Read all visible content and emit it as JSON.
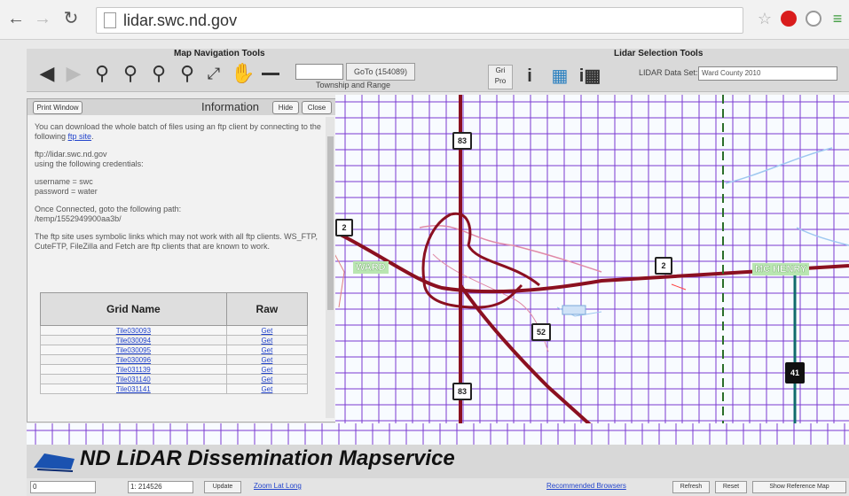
{
  "browser": {
    "url": "lidar.swc.nd.gov",
    "back_icon": "left-arrow-icon",
    "forward_icon": "right-arrow-icon",
    "reload_icon": "reload-icon"
  },
  "toolbar": {
    "nav_title": "Map Navigation Tools",
    "lidar_title": "Lidar Selection Tools",
    "goto_label": "GoTo (154089)",
    "goto_value": "",
    "twp_label": "Township and Range",
    "lidar_dataset_label": "LIDAR Data Set:",
    "lidar_dataset_value": "Ward County 2010"
  },
  "info_panel": {
    "print_label": "Print Window",
    "title": "Information",
    "hide_label": "Hide",
    "close_label": "Close",
    "para1": "You can download the whole batch of files using an ftp client by connecting to the following",
    "para1_link": "ftp site",
    "para2_line1": "ftp://lidar.swc.nd.gov",
    "para2_line2": "using the following credentials:",
    "para3_line1": "username = swc",
    "para3_line2": "password = water",
    "para4_line1": "Once Connected, goto the following path:",
    "para4_line2": "/temp/1552949900aa3b/",
    "para5": "The ftp site uses symbolic links which may not work with all ftp clients. WS_FTP, CuteFTP, FileZilla and Fetch are ftp clients that are known to work.",
    "table_header_name": "Grid Name",
    "table_header_raw": "Raw",
    "rows": [
      {
        "name": "Tile030093",
        "raw": "Get"
      },
      {
        "name": "Tile030094",
        "raw": "Get"
      },
      {
        "name": "Tile030095",
        "raw": "Get"
      },
      {
        "name": "Tile030096",
        "raw": "Get"
      },
      {
        "name": "Tile031139",
        "raw": "Get"
      },
      {
        "name": "Tile031140",
        "raw": "Get"
      },
      {
        "name": "Tile031141",
        "raw": "Get"
      }
    ]
  },
  "map": {
    "towns": [
      "WARD",
      "MC HENRY"
    ],
    "highways": [
      "83",
      "2",
      "2",
      "52",
      "83",
      "41"
    ]
  },
  "banner": {
    "title": "ND LiDAR Dissemination Mapservice"
  },
  "status": {
    "scale_value": "0",
    "zoom_value": "1: 214526",
    "update_label": "Update",
    "zoom_lat_long": "Zoom Lat Long",
    "recommended": "Recommended Browsers",
    "refresh_label": "Refresh",
    "reset_label": "Reset",
    "show_ref_label": "Show Reference Map"
  }
}
